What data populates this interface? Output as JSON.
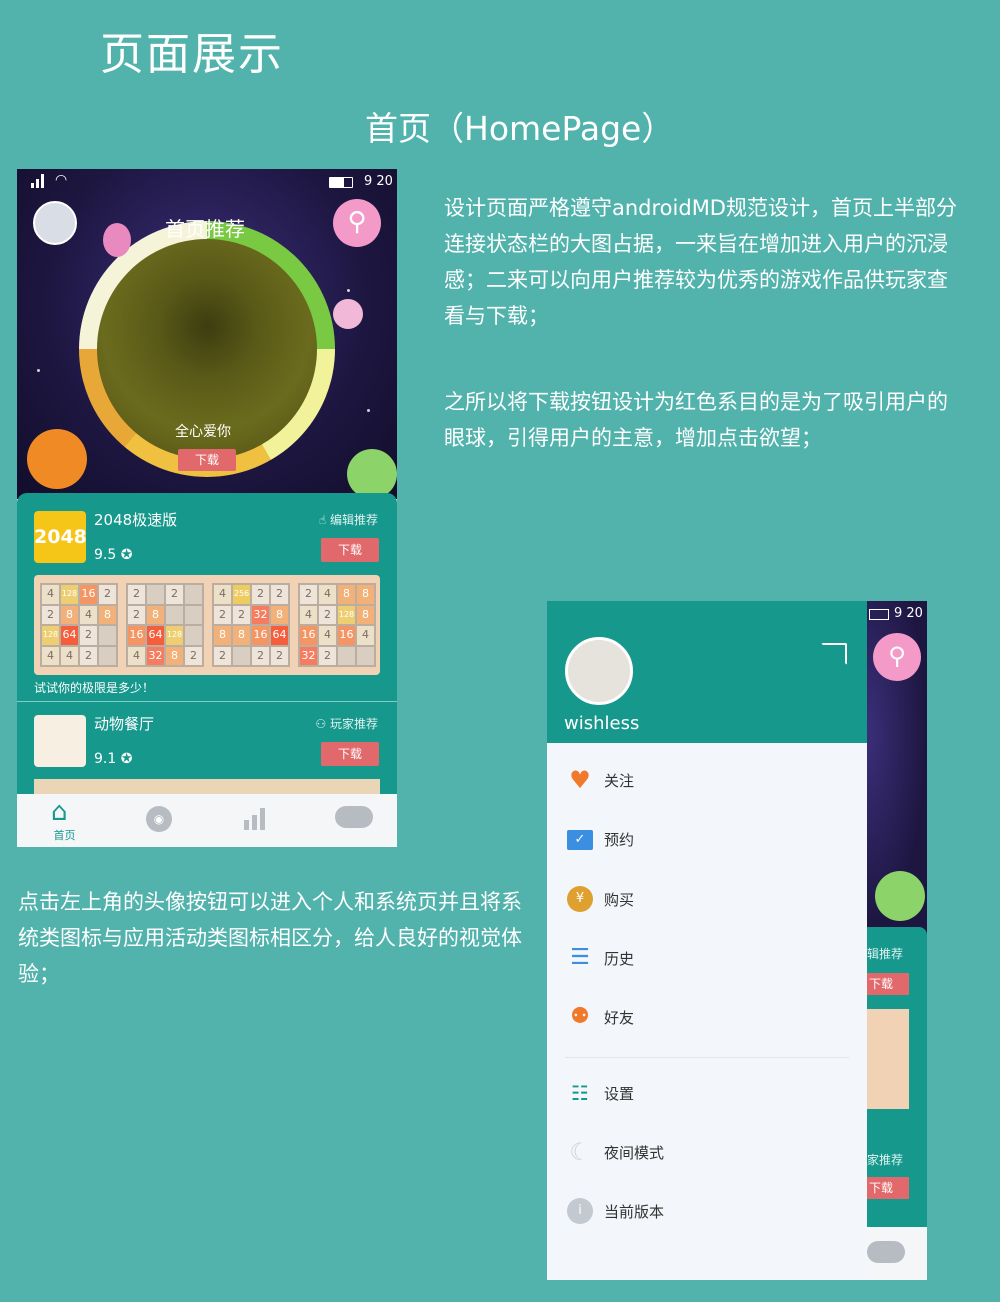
{
  "page": {
    "title": "页面展示",
    "subtitle": "首页（HomePage）",
    "paragraph1": "设计页面严格遵守androidMD规范设计，首页上半部分连接状态栏的大图占据，一来旨在增加进入用户的沉浸感；二来可以向用户推荐较为优秀的游戏作品供玩家查看与下载；",
    "paragraph2": "之所以将下载按钮设计为红色系目的是为了吸引用户的眼球，引得用户的主意，增加点击欲望；",
    "paragraph3": "点击左上角的头像按钮可以进入个人和系统页并且将系统类图标与应用活动类图标相区分，给人良好的视觉体验；"
  },
  "phone1": {
    "status": {
      "time": "9 20"
    },
    "hero": {
      "heading": "首页推荐",
      "slogan": "全心爱你",
      "download": "下载"
    },
    "cards": [
      {
        "name": "2048极速版",
        "score": "9.5 ✪",
        "tag": "编辑推荐",
        "download": "下载",
        "icon_text": "2048",
        "caption": "试试你的极限是多少！"
      },
      {
        "name": "动物餐厅",
        "score": "9.1 ✪",
        "tag": "玩家推荐",
        "download": "下载"
      }
    ],
    "grids": [
      [
        "4",
        "128",
        "16",
        "2",
        "2",
        "8",
        "4",
        "8",
        "128",
        "64",
        "2",
        "",
        "4",
        "4",
        "2",
        ""
      ],
      [
        "2",
        "",
        "2",
        "",
        "2",
        "8",
        "",
        "",
        "16",
        "64",
        "128",
        "",
        "4",
        "32",
        "8",
        "2"
      ],
      [
        "4",
        "256",
        "2",
        "2",
        "2",
        "2",
        "32",
        "8",
        "8",
        "8",
        "16",
        "64",
        "2",
        "",
        "2",
        "2"
      ],
      [
        "2",
        "4",
        "8",
        "8",
        "4",
        "2",
        "128",
        "8",
        "16",
        "4",
        "16",
        "4",
        "32",
        "2",
        "",
        ""
      ]
    ],
    "nav": [
      {
        "label": "首页",
        "icon": "home-icon"
      },
      {
        "label": "",
        "icon": "eye-icon"
      },
      {
        "label": "",
        "icon": "chart-icon"
      },
      {
        "label": "",
        "icon": "gamepad-icon"
      }
    ]
  },
  "phone2": {
    "status": {
      "time": "9 20"
    },
    "user": {
      "name": "wishless"
    },
    "menu_top": [
      {
        "label": "关注",
        "icon": "heart-icon",
        "color": "#f07a2a"
      },
      {
        "label": "预约",
        "icon": "mail-icon",
        "color": "#3b8fe0"
      },
      {
        "label": "购买",
        "icon": "coin-icon",
        "color": "#e0a030"
      },
      {
        "label": "历史",
        "icon": "history-icon",
        "color": "#3b8fe0"
      },
      {
        "label": "好友",
        "icon": "friends-icon",
        "color": "#f07a2a"
      }
    ],
    "menu_bottom": [
      {
        "label": "设置",
        "icon": "settings-icon",
        "color": "#16988c"
      },
      {
        "label": "夜间模式",
        "icon": "moon-icon",
        "color": "#cfd4da"
      },
      {
        "label": "当前版本",
        "icon": "info-icon",
        "color": "#b8c0c8"
      }
    ],
    "peek": {
      "tag1": "辑推荐",
      "download": "下载",
      "tag2": "家推荐"
    }
  },
  "colors": {
    "background": "#52b3ad",
    "teal": "#16988c",
    "download_red": "#e2696b"
  }
}
